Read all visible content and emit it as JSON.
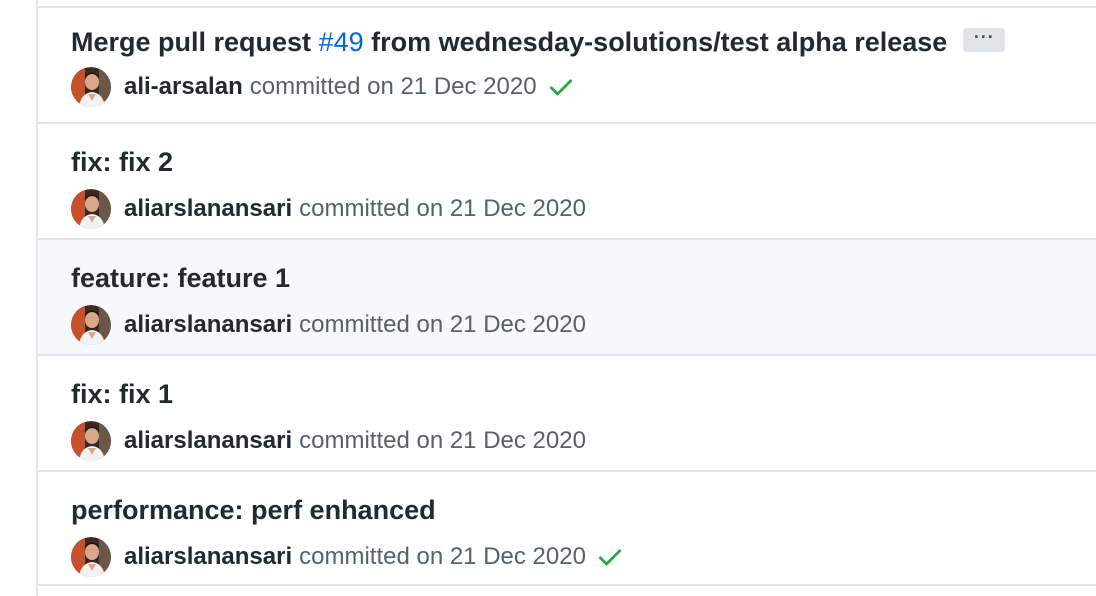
{
  "commits": [
    {
      "title_prefix": "Merge pull request ",
      "pr_link": "#49",
      "title_suffix": " from wednesday-solutions/test alpha release",
      "ellipsis": "···",
      "author": "ali-arsalan",
      "meta": "committed on 21 Dec 2020",
      "status": "success"
    },
    {
      "title": "fix: fix 2",
      "author": "aliarslanansari",
      "meta": "committed on 21 Dec 2020"
    },
    {
      "title": "feature: feature 1",
      "author": "aliarslanansari",
      "meta": "committed on 21 Dec 2020"
    },
    {
      "title": "fix: fix 1",
      "author": "aliarslanansari",
      "meta": "committed on 21 Dec 2020"
    },
    {
      "title": "performance: perf enhanced",
      "author": "aliarslanansari",
      "meta": "committed on 21 Dec 2020",
      "status": "success"
    }
  ],
  "colors": {
    "link": "#0366d6",
    "success": "#28a745",
    "text": "#24292e",
    "muted": "#586069",
    "border": "#e1e4e8",
    "hover_bg": "#f6f8fa"
  }
}
